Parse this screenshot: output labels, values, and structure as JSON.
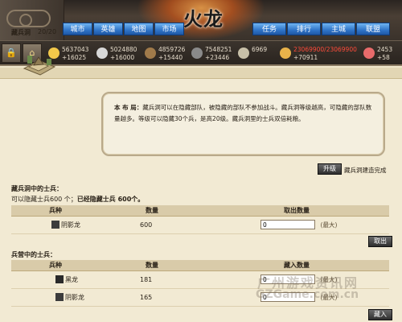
{
  "nav": {
    "left": [
      "城市",
      "英雄",
      "地图",
      "市场"
    ],
    "right": [
      "任务",
      "排行",
      "主城",
      "联盟"
    ]
  },
  "resources": [
    {
      "name": "gold",
      "amount": "5637043",
      "rate": "+16025",
      "color": "#f2c84a"
    },
    {
      "name": "silver",
      "amount": "5024880",
      "rate": "+16000",
      "color": "#d7d7d7"
    },
    {
      "name": "wood",
      "amount": "4859726",
      "rate": "+15440",
      "color": "#a07a4a"
    },
    {
      "name": "stone",
      "amount": "7548251",
      "rate": "+23446",
      "color": "#8a8a8a"
    },
    {
      "name": "population",
      "amount": "6969",
      "rate": "",
      "color": "#c8c0a8"
    },
    {
      "name": "food",
      "amount": "23069900/23069900",
      "rate": "+70911",
      "color": "#e8b24a",
      "warn": true
    },
    {
      "name": "iron",
      "amount": "2453",
      "rate": "+58",
      "color": "#e86b6b"
    }
  ],
  "cave": {
    "label": "藏兵洞",
    "count": "20/20"
  },
  "description": {
    "bold": "本 布 局：",
    "text": "藏兵洞可以在隐藏部队，被隐藏的部队不参加战斗。藏兵洞等级越高，可隐藏的部队数量越多。等级可以隐藏30个兵，是高20级。藏兵洞里的士兵双倍耗粮。"
  },
  "upgrade": {
    "button": "升级",
    "note": "藏兵洞建造完成"
  },
  "cave_soldiers": {
    "title": "藏兵洞中的士兵：",
    "info_prefix": "可以隐藏士兵600 个；",
    "info_bold": "已经隐藏士兵 600个。",
    "headers": [
      "兵种",
      "数量",
      "取出数量"
    ],
    "rows": [
      {
        "unit": "阴影龙",
        "count": "600",
        "input": "0",
        "max": "(最大)"
      }
    ],
    "action": "取出"
  },
  "barracks_soldiers": {
    "title": "兵营中的士兵：",
    "headers": [
      "兵种",
      "数量",
      "藏入数量"
    ],
    "rows": [
      {
        "unit": "黑龙",
        "count": "181",
        "input": "0",
        "max": "(最大)"
      },
      {
        "unit": "阴影龙",
        "count": "165",
        "input": "0",
        "max": "(最大)"
      }
    ],
    "action": "藏入"
  },
  "watermark": {
    "line1": "广州游戏资讯网",
    "line2": "GZGame.com.cn"
  }
}
